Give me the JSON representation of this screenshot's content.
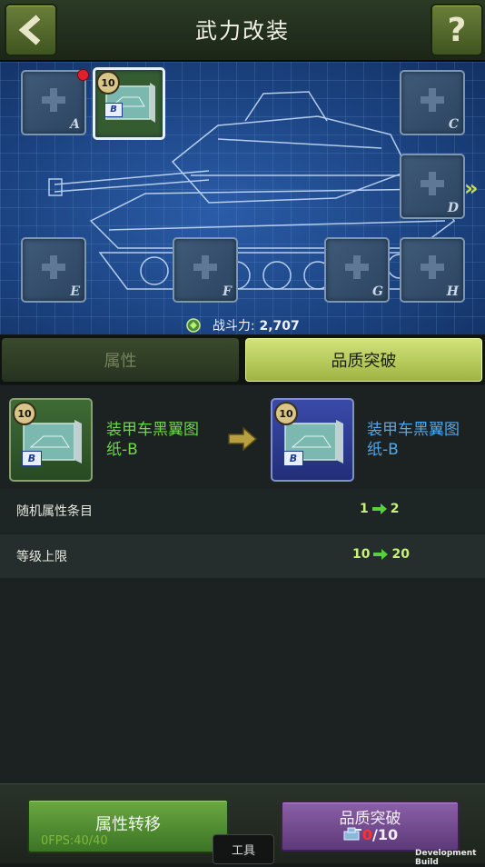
{
  "header": {
    "title": "武力改装",
    "back_icon": "chevron-left-icon",
    "help_label": "?"
  },
  "blueprint": {
    "slots": [
      {
        "letter": "A",
        "empty": true,
        "has_notification": true
      },
      {
        "letter": "B",
        "empty": false,
        "level": "10",
        "badge": "B"
      },
      {
        "letter": "C",
        "empty": true
      },
      {
        "letter": "D",
        "empty": true
      },
      {
        "letter": "E",
        "empty": true
      },
      {
        "letter": "F",
        "empty": true
      },
      {
        "letter": "G",
        "empty": true
      },
      {
        "letter": "H",
        "empty": true
      }
    ],
    "power_label": "战斗力:",
    "power_value": "2,707",
    "next_arrow": "»"
  },
  "tabs": [
    {
      "label": "属性",
      "active": false
    },
    {
      "label": "品质突破",
      "active": true
    }
  ],
  "upgrade": {
    "from": {
      "level": "10",
      "badge": "B",
      "name_line1": "装甲车黑翼图",
      "name_line2": "纸-B",
      "color": "#6fd64a"
    },
    "to": {
      "level": "10",
      "badge": "B",
      "name_line1": "装甲车黑翼图",
      "name_line2": "纸-B",
      "color": "#4ea8f0"
    },
    "stats": [
      {
        "label": "随机属性条目",
        "from": "1",
        "to": "2"
      },
      {
        "label": "等级上限",
        "from": "10",
        "to": "20"
      }
    ]
  },
  "bottom": {
    "transfer_label": "属性转移",
    "breakthrough_label": "品质突破",
    "cost_have": "0",
    "cost_need": "/10",
    "tools_label": "工具",
    "fps_text": "0FPS:40/40",
    "dev_build": "Development Build"
  },
  "colors": {
    "accent_green": "#9fb443",
    "stat_green": "#c8f07a",
    "blueprint_blue": "#1c4482",
    "cost_red": "#ff3030"
  }
}
